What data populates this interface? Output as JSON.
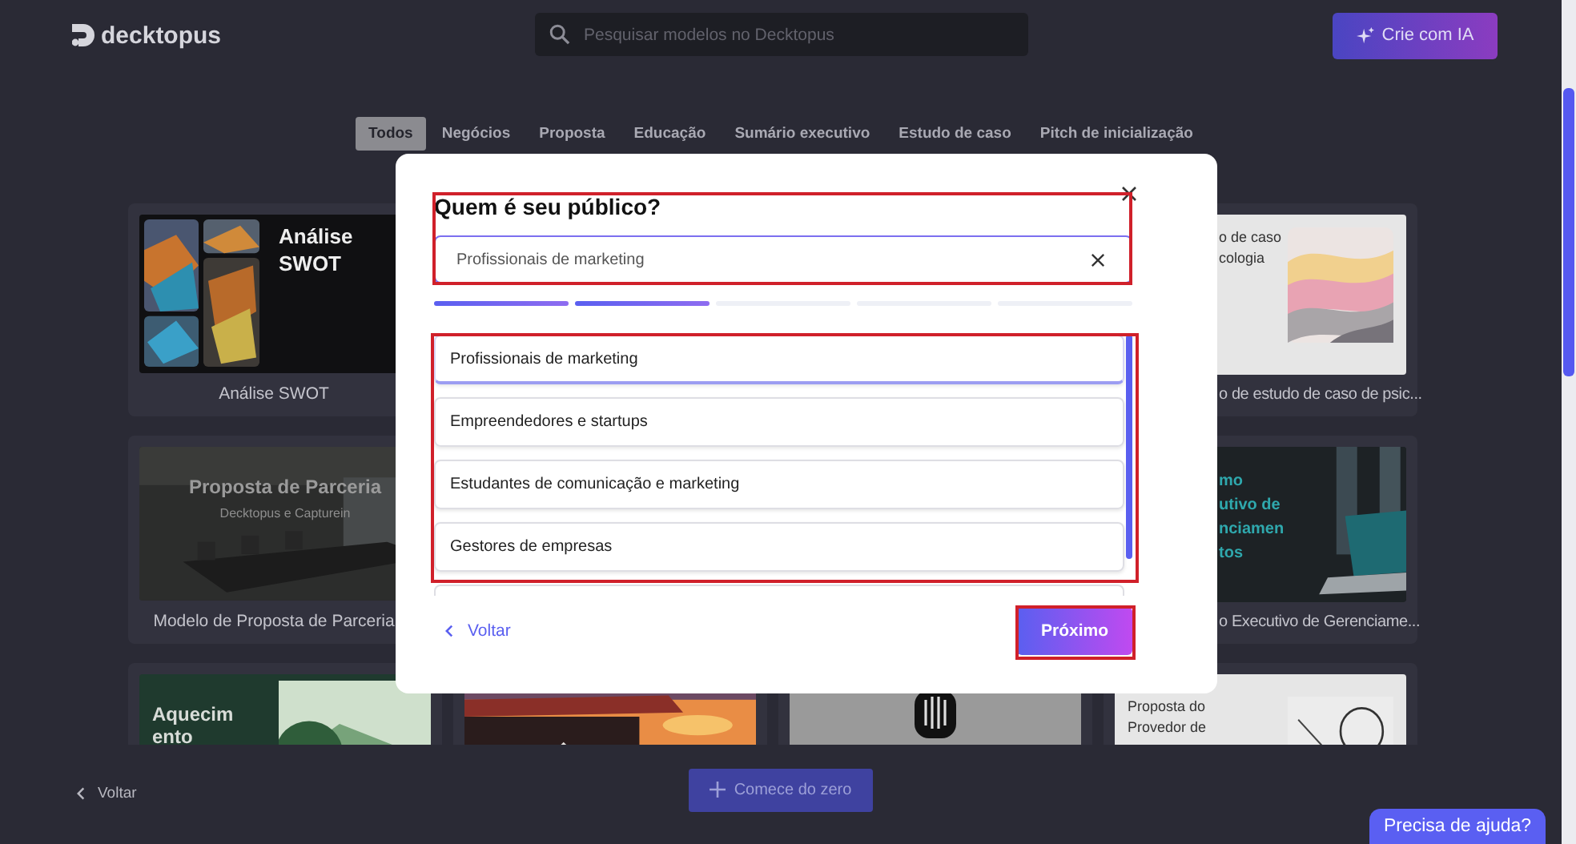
{
  "header": {
    "logo": "decktopus",
    "search": {
      "placeholder": "Pesquisar modelos no Decktopus"
    },
    "ai_button": "Crie com IA"
  },
  "tabs": [
    {
      "label": "Todos",
      "selected": true
    },
    {
      "label": "Negócios",
      "selected": false
    },
    {
      "label": "Proposta",
      "selected": false
    },
    {
      "label": "Educação",
      "selected": false
    },
    {
      "label": "Sumário executivo",
      "selected": false
    },
    {
      "label": "Estudo de caso",
      "selected": false
    },
    {
      "label": "Pitch de inicialização",
      "selected": false
    }
  ],
  "template_rows": [
    {
      "cards": [
        {
          "caption": "Análise SWOT",
          "thumbnail": {
            "kind": "art-tiles",
            "lines": [
              "Análise",
              "SWOT"
            ]
          }
        },
        {
          "caption": "o de estudo de caso de psic...",
          "thumbnail": {
            "kind": "silk",
            "lines": [
              "o de caso",
              "cologia"
            ]
          }
        }
      ]
    },
    {
      "cards": [
        {
          "caption": "Modelo de Proposta de Parceria",
          "thumbnail": {
            "kind": "meeting-room",
            "lines": [
              "Proposta de Parceria"
            ],
            "subtitle": "Decktopus e Capturein"
          }
        },
        {
          "caption": "o Executivo de Gerenciame...",
          "thumbnail": {
            "kind": "laptop",
            "lines": [
              "mo",
              "utivo de",
              "nciamen",
              "tos"
            ]
          }
        }
      ]
    },
    {
      "cards": [
        {
          "thumbnail": {
            "kind": "forest",
            "lines": [
              "Aquecim",
              "ento"
            ]
          }
        },
        {
          "thumbnail": {
            "kind": "sunset"
          }
        },
        {
          "thumbnail": {
            "kind": "microphone"
          }
        },
        {
          "thumbnail": {
            "kind": "network",
            "lines": [
              "Proposta do",
              "Provedor de"
            ]
          }
        }
      ]
    }
  ],
  "dialog": {
    "title": "Quem é seu público?",
    "input": {
      "value": "Profissionais de marketing"
    },
    "progress": [
      {
        "completed": true
      },
      {
        "completed": true
      },
      {
        "completed": false
      },
      {
        "completed": false
      },
      {
        "completed": false
      }
    ],
    "options": [
      {
        "label": "Profissionais de marketing",
        "selected": true
      },
      {
        "label": "Empreendedores e startups",
        "selected": false
      },
      {
        "label": "Estudantes de comunicação e marketing",
        "selected": false
      },
      {
        "label": "Gestores de empresas",
        "selected": false
      }
    ],
    "back": "Voltar",
    "next": "Próximo"
  },
  "footer": {
    "back": "Voltar",
    "start_button": "Comece do zero",
    "help_button": "Precisa de ajuda?"
  }
}
